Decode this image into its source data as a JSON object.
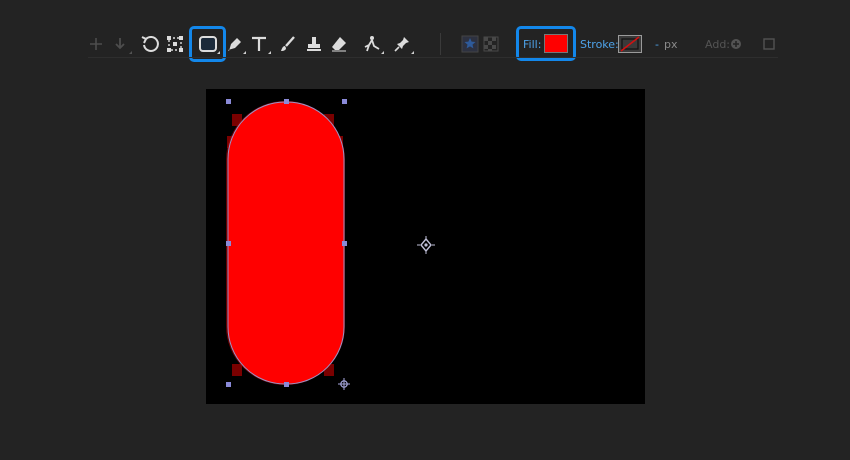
{
  "toolbar": {
    "fill_label": "Fill:",
    "stroke_label": "Stroke:",
    "stroke_width_value": "-",
    "stroke_unit": "px",
    "add_label": "Add:",
    "fill_color": "#ff0000",
    "highlight_color": "#1387ea",
    "tools": [
      {
        "name": "move-down-icon",
        "state": "disabled"
      },
      {
        "name": "undo-icon",
        "state": "enabled"
      },
      {
        "name": "transform-icon",
        "state": "enabled"
      },
      {
        "name": "rectangle-icon",
        "state": "selected"
      },
      {
        "name": "pen-icon",
        "state": "enabled"
      },
      {
        "name": "text-icon",
        "state": "enabled"
      },
      {
        "name": "brush-icon",
        "state": "enabled"
      },
      {
        "name": "stamp-icon",
        "state": "enabled"
      },
      {
        "name": "eraser-icon",
        "state": "enabled"
      },
      {
        "name": "puppet-pin-icon",
        "state": "enabled"
      },
      {
        "name": "pin-icon",
        "state": "enabled"
      },
      {
        "name": "star-icon",
        "state": "disabled"
      },
      {
        "name": "checker-icon",
        "state": "disabled"
      }
    ]
  },
  "canvas": {
    "background": "#000000",
    "shape_color": "#ff0000",
    "shape_type": "rounded-rectangle"
  }
}
